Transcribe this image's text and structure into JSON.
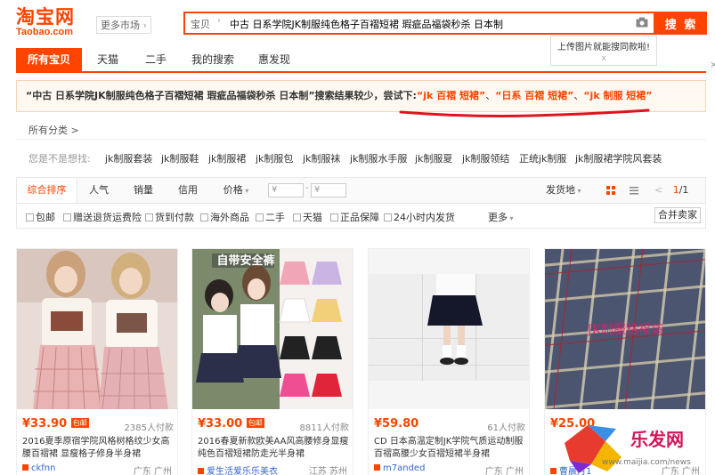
{
  "header": {
    "logo_cn": "淘宝网",
    "logo_en": "Taobao.com",
    "more_market": "更多市场",
    "search_scope": "宝贝",
    "search_query": "中古 日系学院JK制服纯色格子百褶短裙 瑕疵品福袋秒杀 日本制",
    "search_button": "搜 索",
    "hint_text": "上传图片就能搜同款啦!",
    "hint_close": "x"
  },
  "nav": {
    "tabs": [
      "所有宝贝",
      "天猫",
      "二手",
      "我的搜索",
      "惠发现"
    ]
  },
  "notice": {
    "prefix": "“中古 日系学院JK制服纯色格子百褶短裙 瑕疵品福袋秒杀 日本制”搜索结果较少，尝试下:",
    "sug1": "“jk 百褶 短裙”",
    "sep1": "、",
    "sug2": "“日系 百褶 短裙”",
    "sep2": "、",
    "sug3": "“jk 制服 短裙”"
  },
  "breadcrumb": "所有分类 >",
  "did_you_mean": {
    "label": "您是不是想找:",
    "items": [
      "jk制服套装",
      "jk制服鞋",
      "jk制服裙",
      "jk制服包",
      "jk制服袜",
      "jk制服水手服",
      "jk制服夏",
      "jk制服领结",
      "正统jk制服",
      "jk制服裙学院风套装"
    ]
  },
  "sortbar": {
    "tabs": [
      "综合排序",
      "人气",
      "销量",
      "信用",
      "价格"
    ],
    "price_min": "¥",
    "price_max": "¥",
    "price_dash": "-",
    "ship_from": "发货地",
    "pager_prev": "<",
    "pager_current": "1",
    "pager_total": "/1",
    "pager_next": ">"
  },
  "filters": {
    "items": [
      "包邮",
      "赠送退货运费险",
      "货到付款",
      "海外商品",
      "二手",
      "天猫",
      "正品保障",
      "24小时内发货"
    ],
    "more": "更多",
    "merge": "合并卖家"
  },
  "products": [
    {
      "price": "¥33.90",
      "baoyou": "包邮",
      "sales": "2385人付款",
      "title": "2016夏季原宿学院风格树格纹少女高腰百褶裙 显瘦格子修身半身裙",
      "shop": "ckfnn",
      "location": "广东 广州"
    },
    {
      "price": "¥33.00",
      "baoyou": "包邮",
      "sales": "8811人付款",
      "title": "2016春夏新款欧美AA风高腰修身显瘦纯色百褶短裙防走光半身裙",
      "shop": "爱生活爱乐乐美衣",
      "location": "江苏 苏州",
      "img_label": "自带安全裤"
    },
    {
      "price": "¥59.80",
      "baoyou": "",
      "sales": "61人付款",
      "title": "CD 日本高温定制JK学院气质运动制服百褶高腰少女百褶短裙半身裙",
      "shop": "m7anded",
      "location": "广东 广州"
    },
    {
      "price": "¥25.00",
      "baoyou": "",
      "sales": "",
      "title": "",
      "shop": "曹晨月1",
      "location": "广东 广州",
      "img_label": "JK制服格福袋"
    }
  ],
  "watermark": {
    "text": "乐发网",
    "url": "www.maijia.com/news"
  },
  "colors": {
    "brand": "#ff4400"
  }
}
